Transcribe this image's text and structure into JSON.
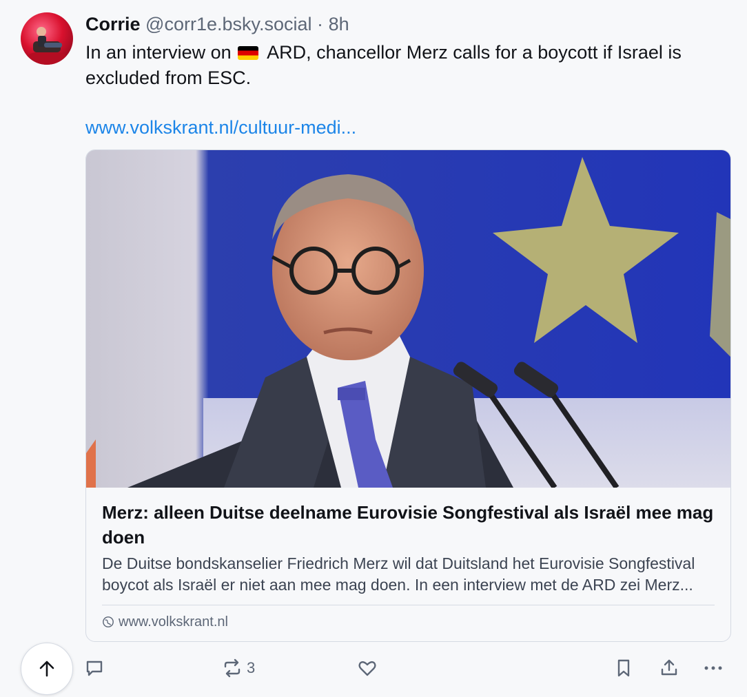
{
  "post": {
    "author": "Corrie",
    "handle": "@corr1e.bsky.social",
    "separator": "·",
    "time": "8h",
    "text_before_flag": "In an interview on",
    "flag_icon": "germany-flag-emoji",
    "text_after_flag": "ARD, chancellor Merz calls for a boycott if Israel is excluded from ESC.",
    "link_text": "www.volkskrant.nl/cultuur-medi..."
  },
  "card": {
    "title": "Merz: alleen Duitse deelname Eurovisie Songfestival als Israël mee mag doen",
    "description": "De Duitse bondskanselier Friedrich Merz wil dat Duitsland het Eurovisie Songfestival boycot als Israël er niet aan mee mag doen. In een interview met de ARD zei Merz...",
    "domain": "www.volkskrant.nl"
  },
  "actions": {
    "repost_count": "3"
  },
  "colors": {
    "link": "#1c85e8",
    "muted": "#5d6777",
    "background": "#f7f8fa",
    "border": "#d5dae3"
  }
}
